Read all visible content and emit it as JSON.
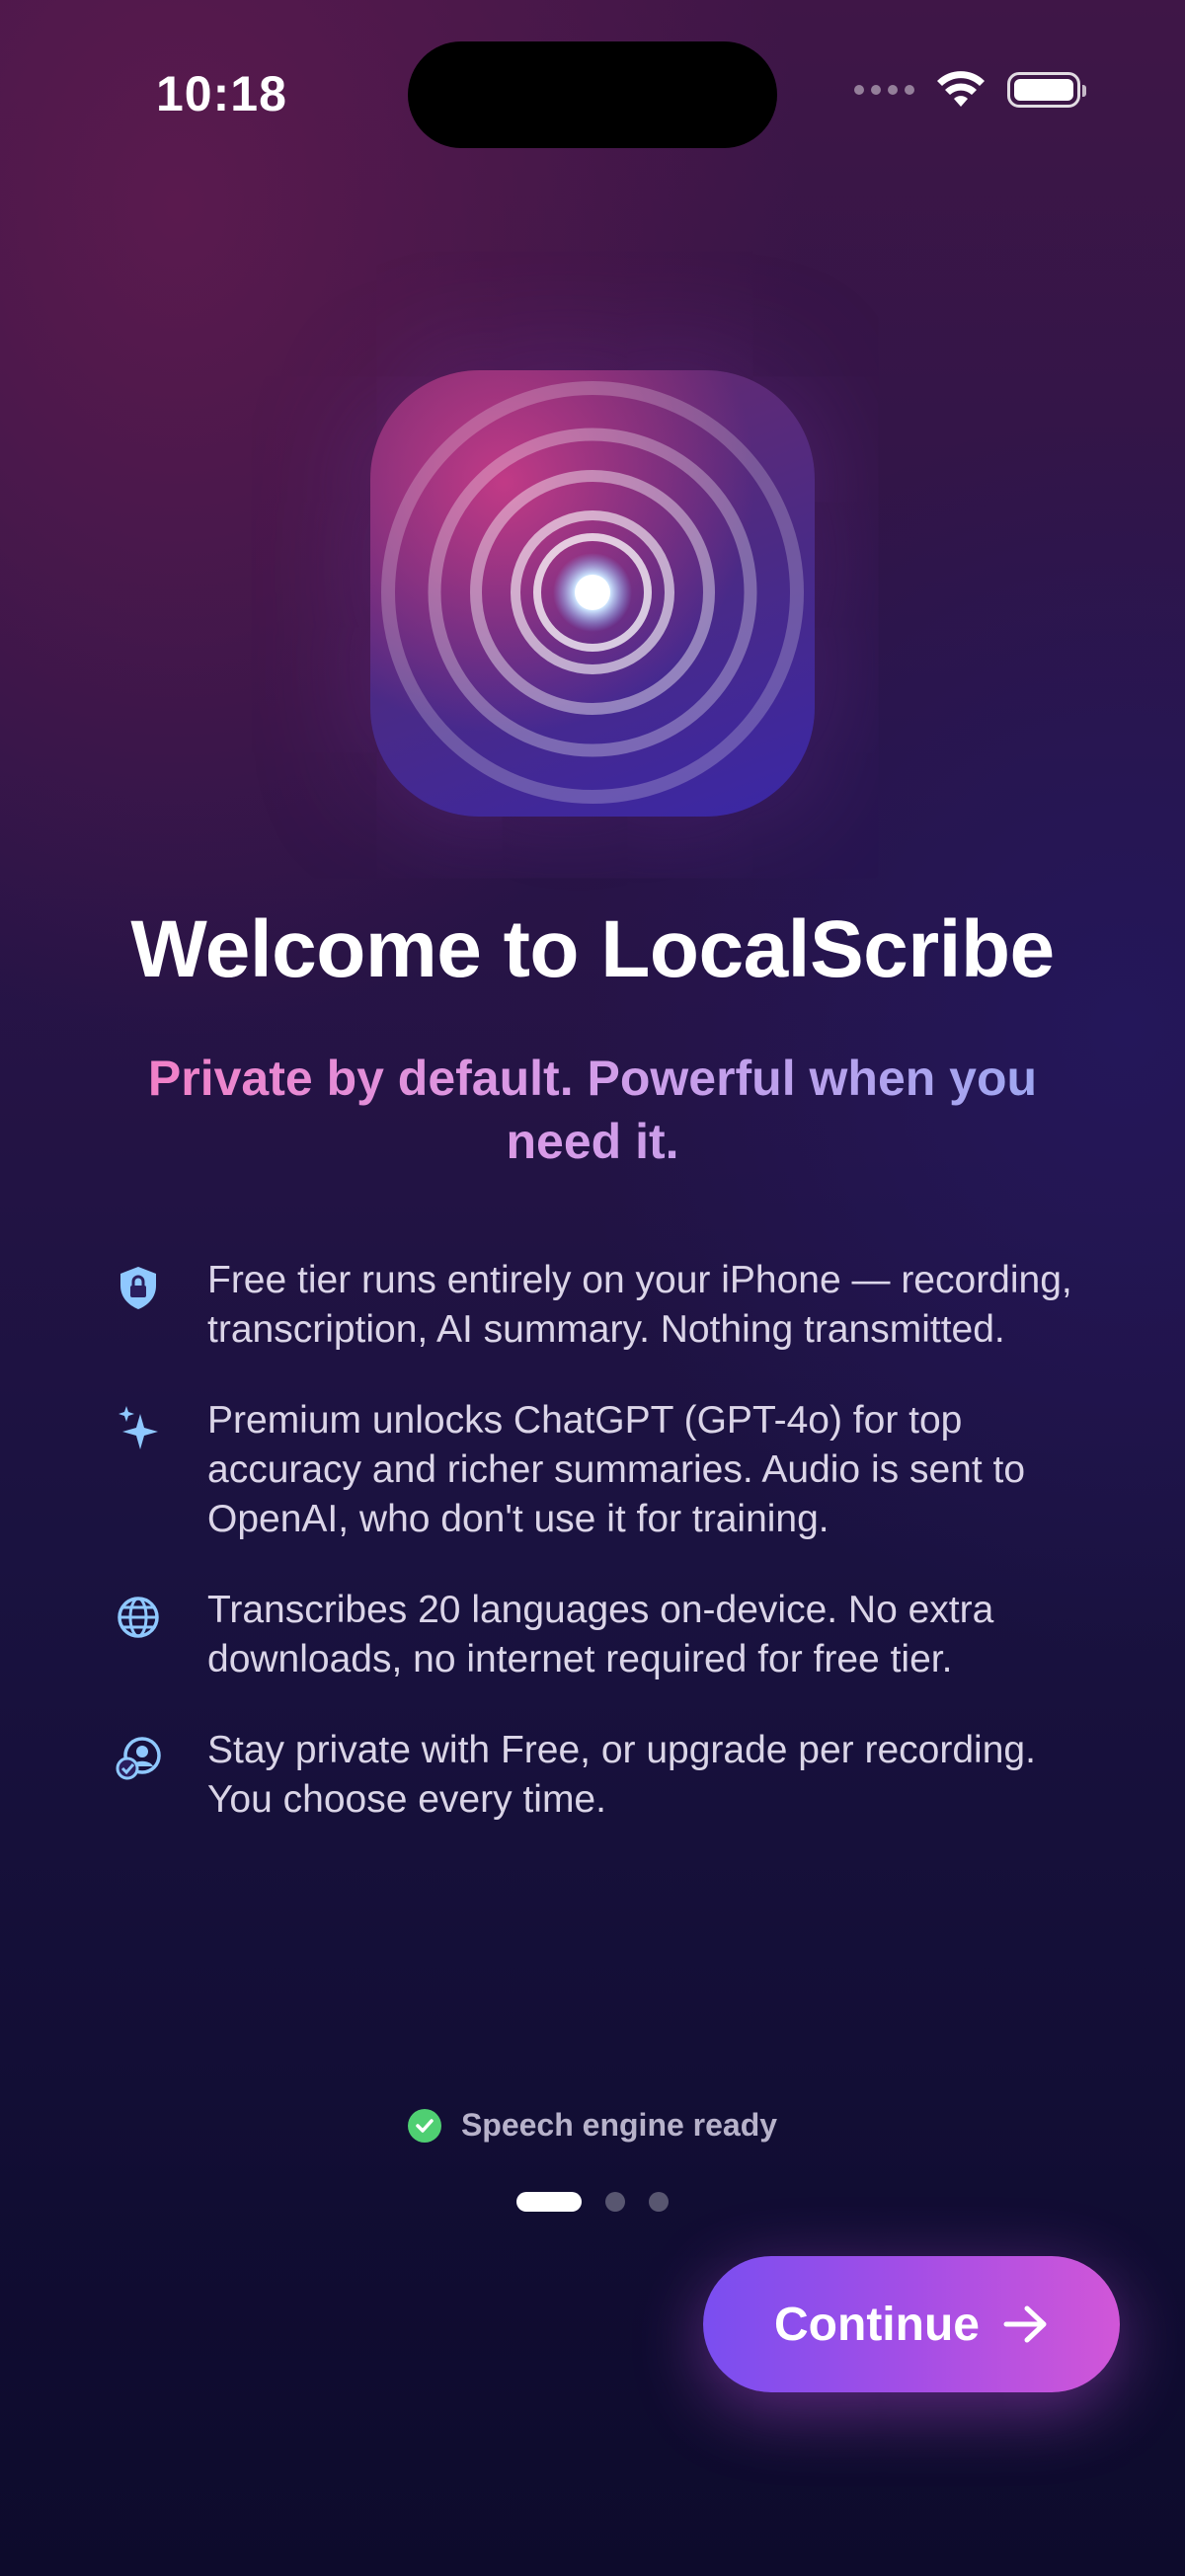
{
  "status_bar": {
    "time": "10:18"
  },
  "app": {
    "icon": "concentric-rings-app-icon",
    "accent_pink": "#c13a86",
    "accent_purple": "#3a27a6"
  },
  "onboarding": {
    "title": "Welcome to LocalScribe",
    "subtitle": "Private by default. Powerful when you need it.",
    "features": [
      {
        "icon": "shield-lock-icon",
        "text": "Free tier runs entirely on your iPhone — recording, transcription, AI summary. Nothing transmitted."
      },
      {
        "icon": "sparkles-icon",
        "text": "Premium unlocks ChatGPT (GPT-4o) for top accuracy and richer summaries. Audio is sent to OpenAI, who don't use it for training."
      },
      {
        "icon": "globe-icon",
        "text": "Transcribes 20 languages on-device. No extra downloads, no internet required for free tier."
      },
      {
        "icon": "person-check-icon",
        "text": "Stay private with Free, or upgrade per recording. You choose every time."
      }
    ],
    "engine_status": "Speech engine ready",
    "engine_status_color": "#4fcf72",
    "page_indicator": {
      "current": 1,
      "total": 3
    },
    "continue_label": "Continue",
    "continue_gradient": [
      "#7a4ef0",
      "#d156d8"
    ]
  }
}
